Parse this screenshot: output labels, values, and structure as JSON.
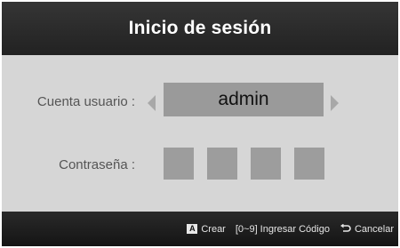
{
  "dialog": {
    "title": "Inicio de sesión"
  },
  "form": {
    "user_label": "Cuenta usuario :",
    "user_value": "admin",
    "password_label": "Contraseña :",
    "password_digits": 4
  },
  "footer": {
    "create_key": "A",
    "create_label": "Crear",
    "enter_code_label": "[0~9] Ingresar Código",
    "cancel_icon": "return-icon",
    "cancel_label": "Cancelar"
  },
  "colors": {
    "header_bg": "#2c2c2c",
    "body_bg": "#d6d6d6",
    "field_bg": "#9a9a9a",
    "footer_bg": "#1c1c1c"
  }
}
